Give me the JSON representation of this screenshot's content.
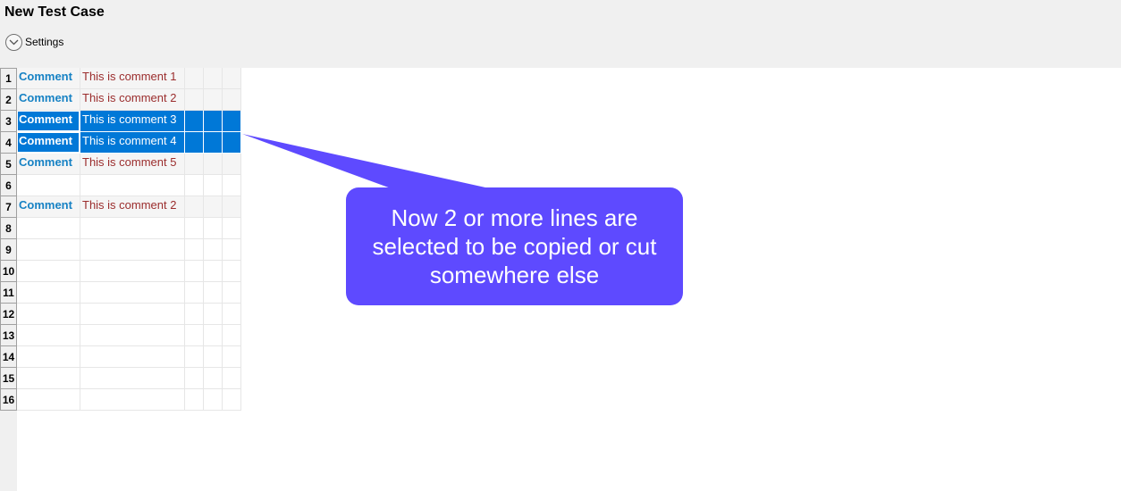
{
  "window": {
    "title": "New Test Case"
  },
  "settings": {
    "label": "Settings"
  },
  "rows": [
    {
      "num": "1",
      "keyword": "Comment",
      "arg": "This is comment 1",
      "selected": false
    },
    {
      "num": "2",
      "keyword": "Comment",
      "arg": "This is comment 2",
      "selected": false
    },
    {
      "num": "3",
      "keyword": "Comment",
      "arg": "This is comment 3",
      "selected": true
    },
    {
      "num": "4",
      "keyword": "Comment",
      "arg": "This is comment 4",
      "selected": true
    },
    {
      "num": "5",
      "keyword": "Comment",
      "arg": "This is comment 5",
      "selected": false
    },
    {
      "num": "6",
      "keyword": "",
      "arg": "",
      "selected": false
    },
    {
      "num": "7",
      "keyword": "Comment",
      "arg": "This is comment 2",
      "selected": false
    },
    {
      "num": "8",
      "keyword": "",
      "arg": "",
      "selected": false
    },
    {
      "num": "9",
      "keyword": "",
      "arg": "",
      "selected": false
    },
    {
      "num": "10",
      "keyword": "",
      "arg": "",
      "selected": false
    },
    {
      "num": "11",
      "keyword": "",
      "arg": "",
      "selected": false
    },
    {
      "num": "12",
      "keyword": "",
      "arg": "",
      "selected": false
    },
    {
      "num": "13",
      "keyword": "",
      "arg": "",
      "selected": false
    },
    {
      "num": "14",
      "keyword": "",
      "arg": "",
      "selected": false
    },
    {
      "num": "15",
      "keyword": "",
      "arg": "",
      "selected": false
    },
    {
      "num": "16",
      "keyword": "",
      "arg": "",
      "selected": false
    }
  ],
  "callout": {
    "text": "Now 2 or more lines are selected to be copied or cut somewhere else",
    "color": "#5e4aff"
  },
  "colors": {
    "selection": "#0078d7",
    "keyword": "#1782c4",
    "argument": "#9b2d2d"
  }
}
